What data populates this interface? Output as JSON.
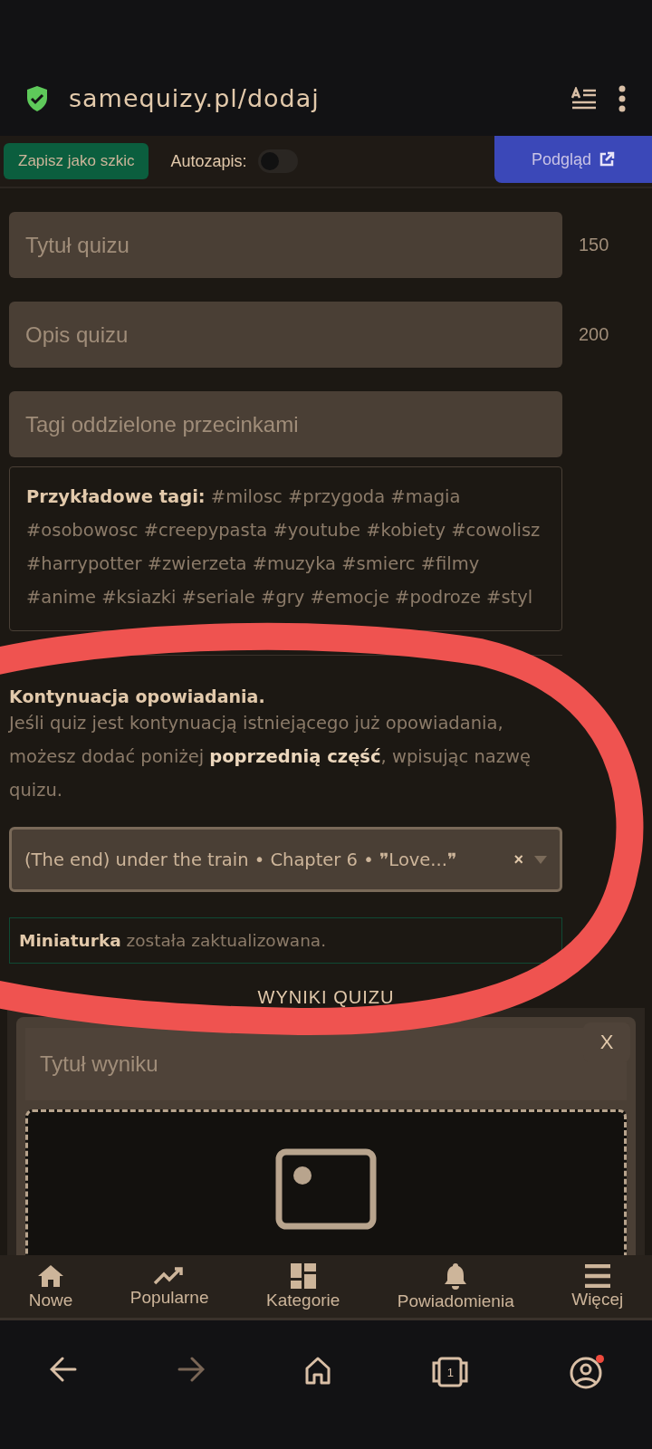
{
  "browser": {
    "url": "samequizy.pl/dodaj"
  },
  "toolbar": {
    "save_draft": "Zapisz jako szkic",
    "autosave": {
      "label": "Autozapis:",
      "on": false
    },
    "preview": "Podgląd"
  },
  "fields": [
    {
      "placeholder": "Tytuł quizu",
      "counter": "150"
    },
    {
      "placeholder": "Opis quizu",
      "counter": "200"
    },
    {
      "placeholder": "Tagi oddzielone przecinkami"
    }
  ],
  "example_tags": "**Przykładowe tagi:** #milosc #przygoda #magia #osobowosc #creepypasta #youtube #kobiety #cowolisz #harrypotter #zwierzeta #muzyka #smierc #filmy #anime #ksiazki #seriale #gry #emocje #podroze #styl",
  "continuation": {
    "title": "Kontynuacja opowiadania.",
    "text": "Jeśli quiz jest kontynuacją istniejącego już opowiadania, możesz dodać poniżej **poprzednią część**, wpisując nazwę quizu.",
    "select_value": "(The end) under the train • Chapter 6 • ❞Love...❞",
    "clear": "×"
  },
  "notice": "**Miniaturka** została zaktualizowana.",
  "results_heading": "WYNIKI QUIZU",
  "result_card": {
    "close": "X",
    "title_placeholder": "Tytuł wyniku"
  },
  "bottom_nav": [
    {
      "label": "Nowe",
      "kind": "home"
    },
    {
      "label": "Popularne",
      "kind": "trend"
    },
    {
      "label": "Kategorie",
      "kind": "grid"
    },
    {
      "label": "Powiadomienia",
      "kind": "bell"
    },
    {
      "label": "Więcej",
      "kind": "menu"
    }
  ],
  "system_nav": {
    "back_disabled": false,
    "forward_disabled": true,
    "tab_count": "1",
    "profile_badge": true
  }
}
